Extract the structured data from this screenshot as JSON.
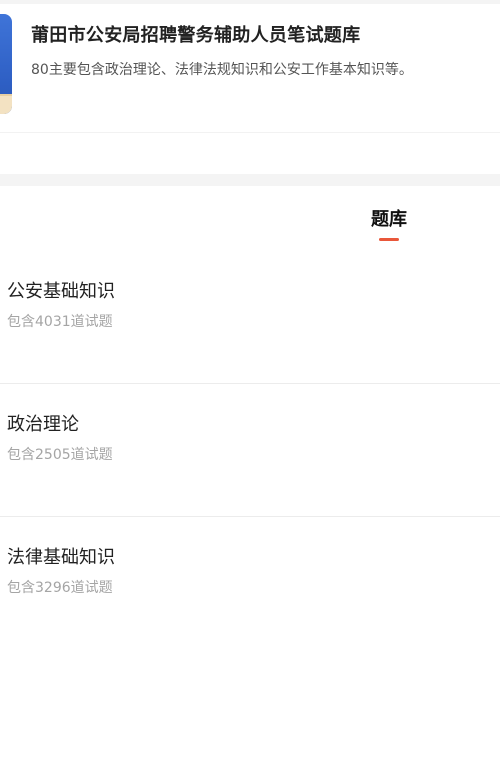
{
  "bank": {
    "title": "莆田市公安局招聘警务辅助人员笔试题库",
    "description": "80主要包含政治理论、法律法规知识和公安工作基本知识等。",
    "cover_icon": "book-cover-icon"
  },
  "tabs": [
    {
      "label": "题库",
      "active": true
    }
  ],
  "accent_color": "#e9573a",
  "categories": [
    {
      "name": "公安基础知识",
      "count_text": "包含4031道试题"
    },
    {
      "name": "政治理论",
      "count_text": "包含2505道试题"
    },
    {
      "name": "法律基础知识",
      "count_text": "包含3296道试题"
    }
  ]
}
